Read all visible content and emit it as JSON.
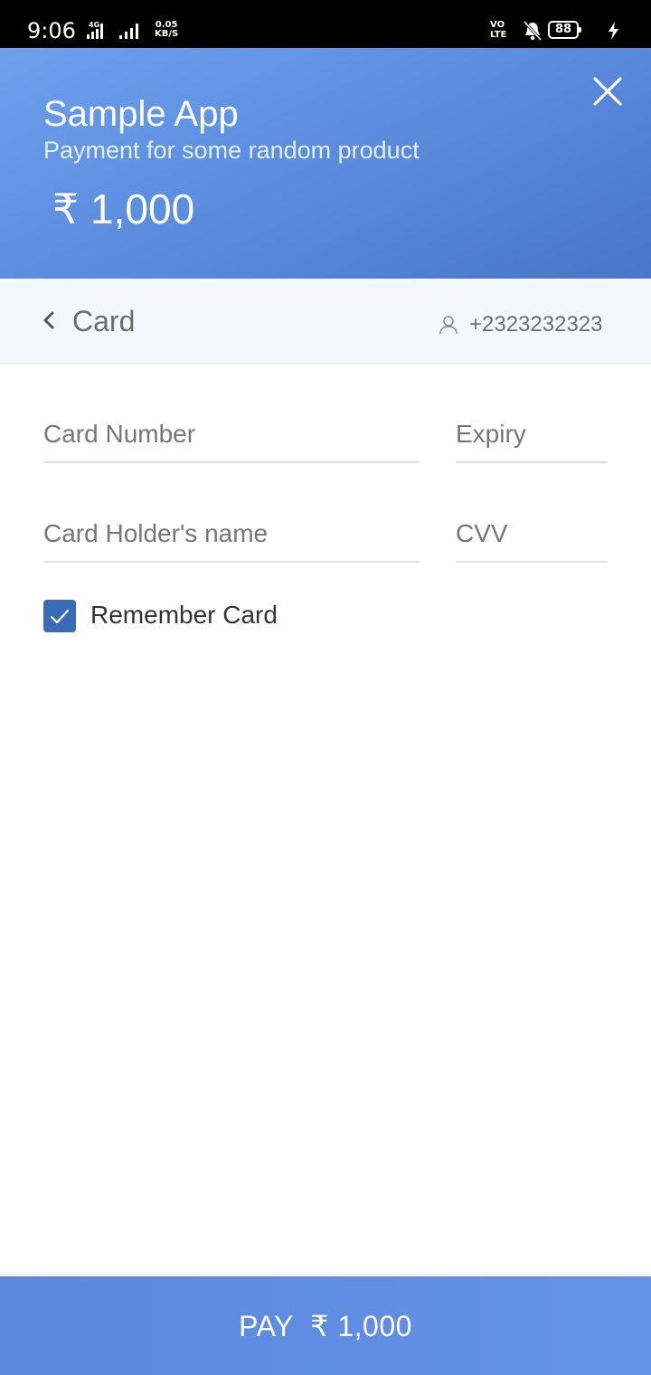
{
  "status_bar": {
    "time": "9:06",
    "network_type": "4G",
    "speed_value": "0.05",
    "speed_unit": "KB/S",
    "volte_top": "VO",
    "volte_bottom": "LTE",
    "battery": "88"
  },
  "header": {
    "app_name": "Sample App",
    "description": "Payment for some random product",
    "amount": "₹ 1,000"
  },
  "subheader": {
    "title": "Card",
    "contact": "+2323232323"
  },
  "form": {
    "card_number_placeholder": "Card Number",
    "expiry_placeholder": "Expiry",
    "holder_placeholder": "Card Holder's name",
    "cvv_placeholder": "CVV",
    "remember_label": "Remember Card",
    "remember_checked": true
  },
  "pay_button": {
    "label": "PAY  ₹ 1,000"
  },
  "colors": {
    "header_gradient_start": "#6fa0ee",
    "header_gradient_end": "#4876c8",
    "checkbox": "#3a6bb8",
    "pay_button": "#5c8ee0"
  },
  "icons": [
    "close-icon",
    "chevron-left-icon",
    "user-icon",
    "check-icon",
    "mute-bell-icon",
    "charging-icon"
  ]
}
